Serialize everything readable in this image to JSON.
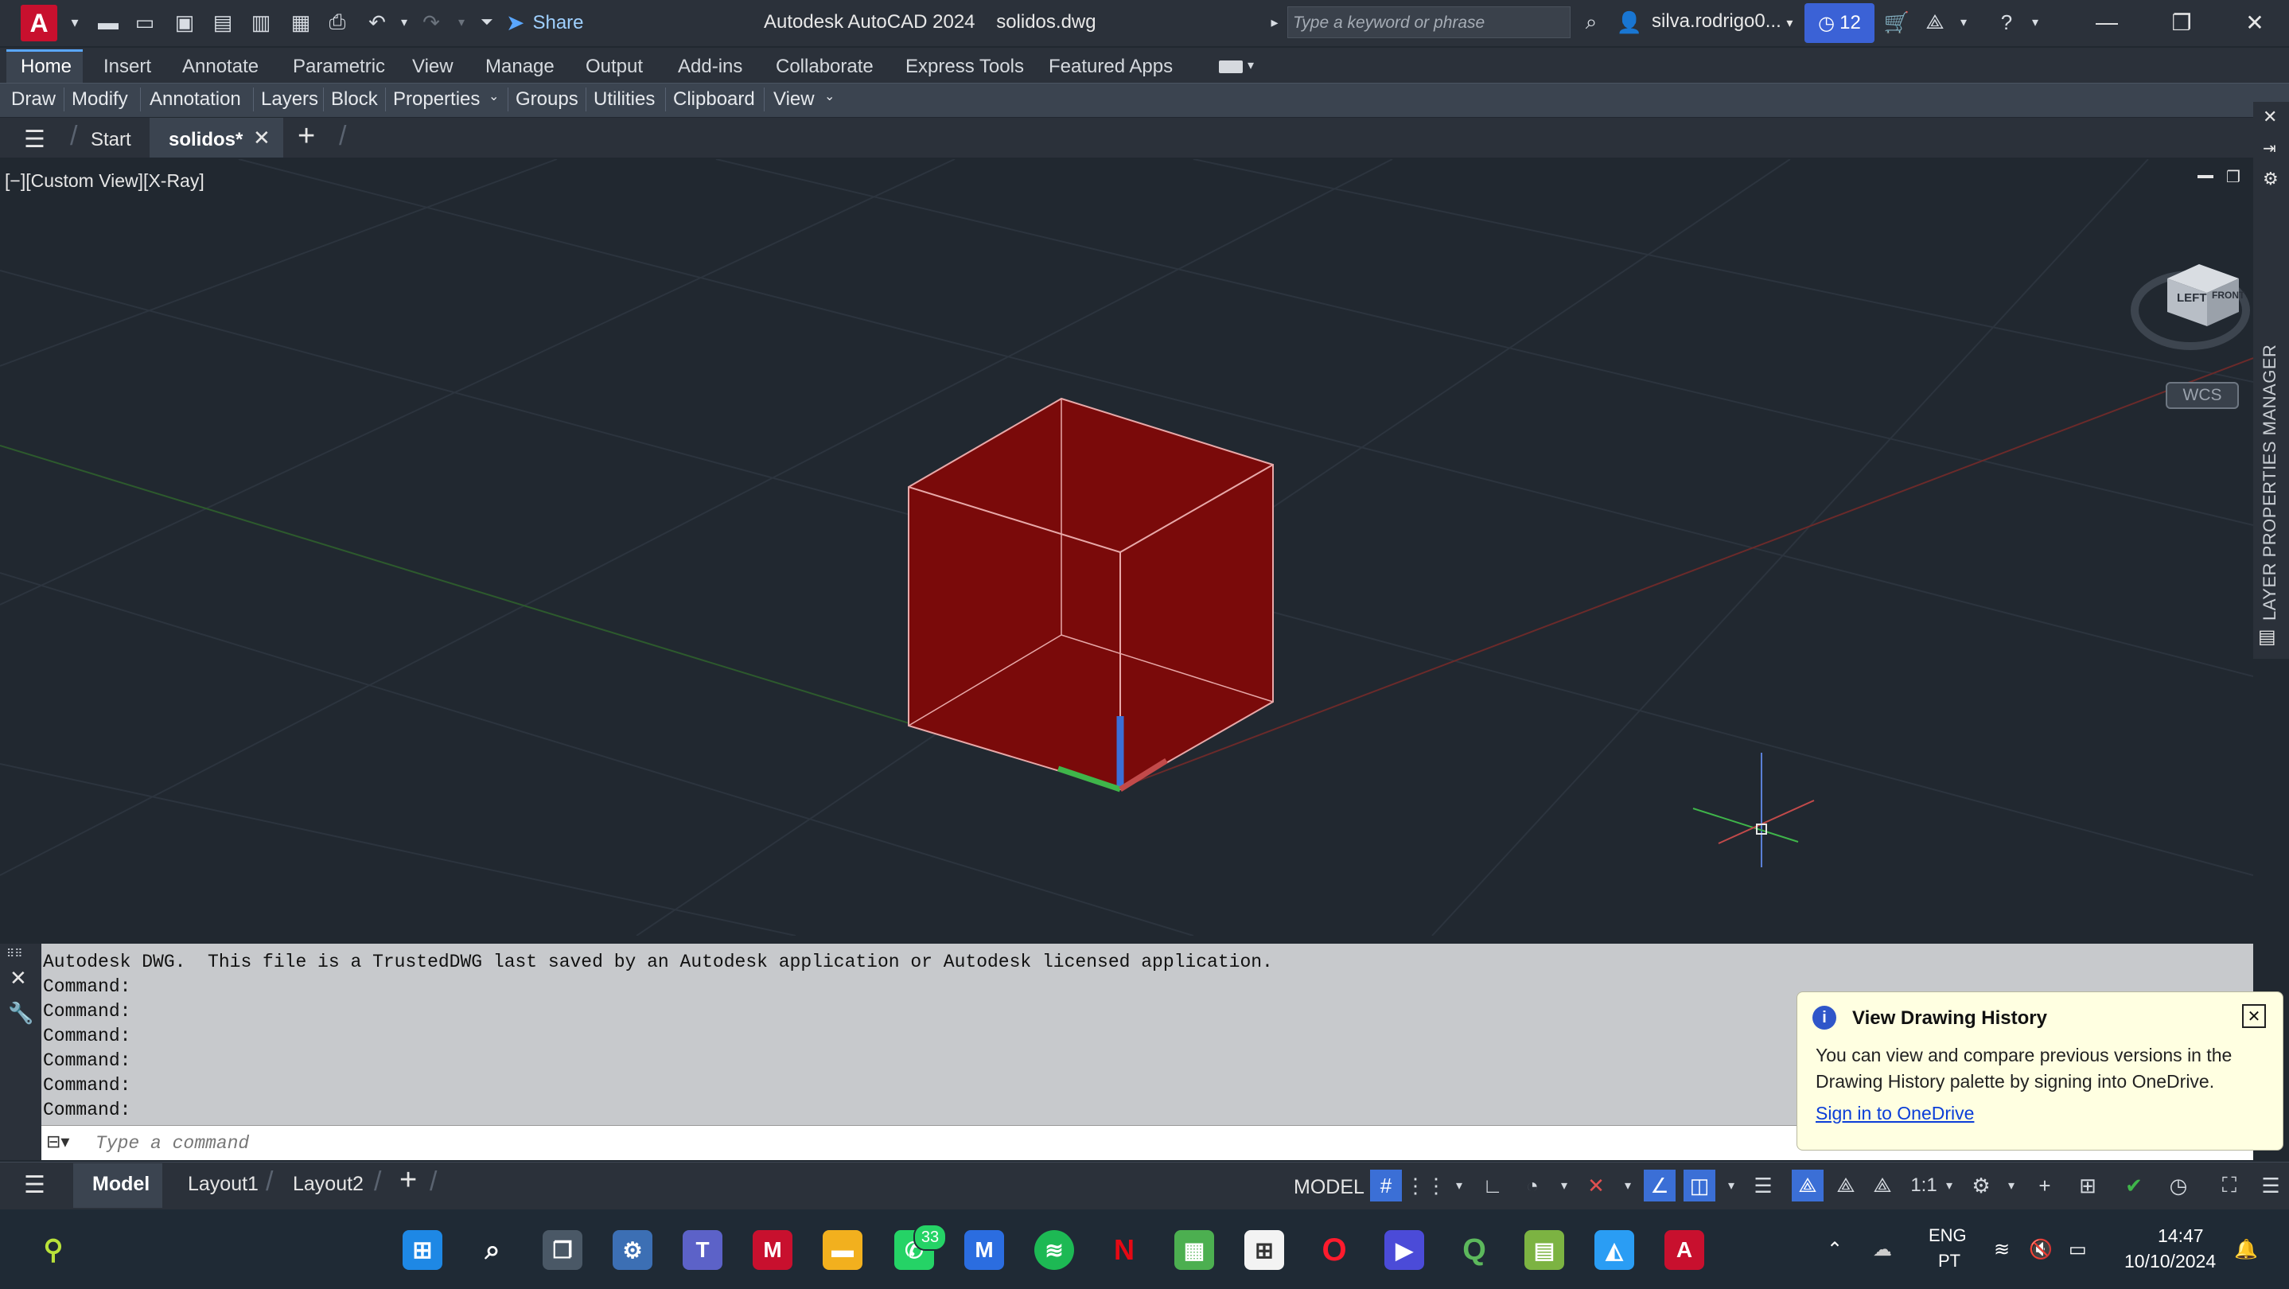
{
  "titlebar": {
    "app_letter": "A",
    "share_label": "Share",
    "app_title": "Autodesk AutoCAD 2024",
    "file_name": "solidos.dwg",
    "search_placeholder": "Type a keyword or phrase",
    "user": "silva.rodrigo0...",
    "trial_count": "12"
  },
  "ribbon": {
    "tabs": [
      "Home",
      "Insert",
      "Annotate",
      "Parametric",
      "View",
      "Manage",
      "Output",
      "Add-ins",
      "Collaborate",
      "Express Tools",
      "Featured Apps"
    ],
    "panels": [
      "Draw",
      "Modify",
      "Annotation",
      "Layers",
      "Block",
      "Properties",
      "Groups",
      "Utilities",
      "Clipboard",
      "View"
    ]
  },
  "file_tabs": {
    "start": "Start",
    "active": "solidos*"
  },
  "viewport": {
    "view_label": "[−][Custom View][X-Ray]",
    "viewcube": {
      "left": "LEFT",
      "front": "FRONT",
      "wcs": "WCS"
    },
    "side_panel_title": "LAYER PROPERTIES MANAGER",
    "solid_color": "#7a0a0a"
  },
  "command": {
    "history": [
      "Autodesk DWG.  This file is a TrustedDWG last saved by an Autodesk application or Autodesk licensed application.",
      "Command:",
      "Command:",
      "Command:",
      "Command:",
      "Command:",
      "Command:"
    ],
    "placeholder": "Type a command"
  },
  "notification": {
    "title": "View Drawing History",
    "body": "You can view and compare previous versions in the Drawing History palette by signing into OneDrive.",
    "link": "Sign in to OneDrive"
  },
  "layout_tabs": [
    "Model",
    "Layout1",
    "Layout2"
  ],
  "status": {
    "space": "MODEL",
    "scale": "1:1"
  },
  "taskbar": {
    "whatsapp_badge": "33",
    "lang": "ENG",
    "region": "PT",
    "time": "14:47",
    "date": "10/10/2024"
  }
}
